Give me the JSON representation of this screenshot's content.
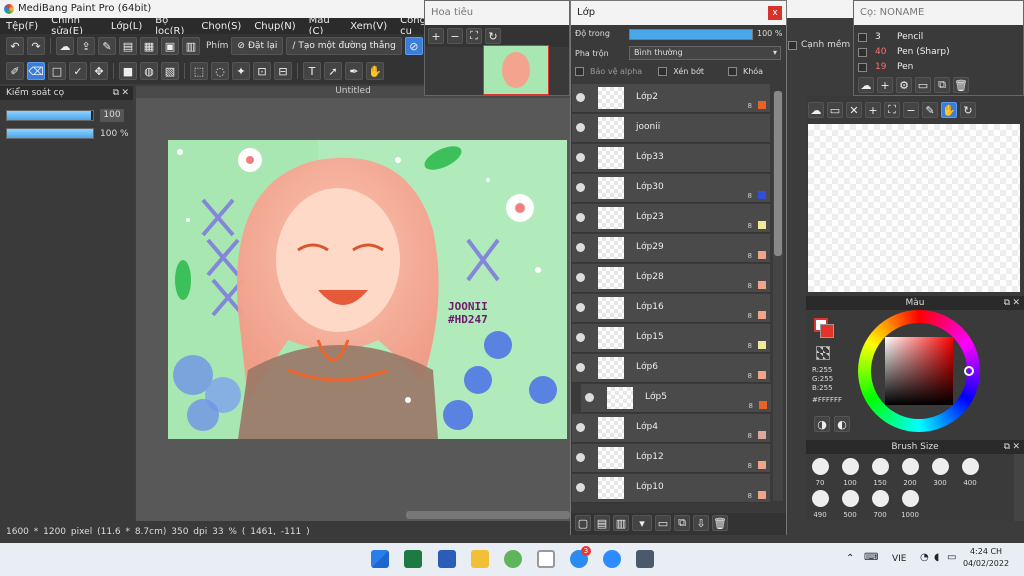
{
  "app": {
    "title": "MediBang Paint Pro (64bit)"
  },
  "menu": [
    "Tệp(F)",
    "Chỉnh sửa(E)",
    "Lớp(L)",
    "Bộ lọc(R)",
    "Chọn(S)",
    "Chụp(N)",
    "Màu (C)",
    "Xem(V)",
    "Công cụ"
  ],
  "toolbar": {
    "key_label": "Phím",
    "reset_label": "Đặt lại",
    "line_label": "Tạo một đường thẳng",
    "smooth_label": "Cạnh mềm"
  },
  "brush_control": {
    "title": "Kiểm soát cọ",
    "size_value": "100",
    "opacity_value": "100 %",
    "size_fraction": 0.98,
    "opacity_fraction": 1.0
  },
  "canvas": {
    "doc_title": "Untitled",
    "signature_line1": "JOONII",
    "signature_line2": "#HD247"
  },
  "status": {
    "size": "1600 * 1200 pixel",
    "cm": "(11.6 * 8.7cm)",
    "dpi": "350 dpi",
    "zoom": "33 %",
    "coords": "( 1461, -111 )"
  },
  "navigator": {
    "title": "Hoa tiêu"
  },
  "layers": {
    "title": "Lớp",
    "opacity_label": "Độ trong",
    "opacity_value": "100 %",
    "blend_label": "Pha trộn",
    "blend_value": "Bình thường",
    "protect_alpha": "Bảo vệ alpha",
    "clip": "Xén bớt",
    "lock": "Khóa",
    "items": [
      {
        "name": "Lớp2",
        "bits": "8",
        "color": "#e8632a"
      },
      {
        "name": "joonii",
        "bits": "",
        "color": ""
      },
      {
        "name": "Lớp33",
        "bits": "",
        "color": ""
      },
      {
        "name": "Lớp30",
        "bits": "8",
        "color": "#2f4fd8"
      },
      {
        "name": "Lớp23",
        "bits": "8",
        "color": "#f3e99b"
      },
      {
        "name": "Lớp29",
        "bits": "8",
        "color": "#f0a58a"
      },
      {
        "name": "Lớp28",
        "bits": "8",
        "color": "#f0a58a"
      },
      {
        "name": "Lớp16",
        "bits": "8",
        "color": "#f0a58a"
      },
      {
        "name": "Lớp15",
        "bits": "8",
        "color": "#f3e99b"
      },
      {
        "name": "Lớp6",
        "bits": "8",
        "color": "#f0a58a"
      },
      {
        "name": "Lớp5",
        "bits": "8",
        "color": "#e8632a"
      },
      {
        "name": "Lớp4",
        "bits": "8",
        "color": "#d9a89a"
      },
      {
        "name": "Lớp12",
        "bits": "8",
        "color": "#f0a58a"
      },
      {
        "name": "Lớp10",
        "bits": "8",
        "color": "#f0a58a"
      }
    ]
  },
  "brush_list": {
    "title": "Cọ: NONAME",
    "items": [
      {
        "size": "3",
        "name": "Pencil",
        "color": "#eeeeee"
      },
      {
        "size": "40",
        "name": "Pen (Sharp)",
        "color": "#ff6b6b"
      },
      {
        "size": "19",
        "name": "Pen",
        "color": "#ff6b6b"
      }
    ]
  },
  "color_panel": {
    "title": "Màu",
    "r": "R:255",
    "g": "G:255",
    "b": "B:255",
    "hex": "#FFFFFF"
  },
  "brush_size": {
    "title": "Brush Size",
    "sizes": [
      "70",
      "100",
      "150",
      "200",
      "300",
      "400",
      "490",
      "500",
      "700",
      "1000"
    ]
  },
  "taskbar": {
    "lang": "VIE",
    "time": "4:24 CH",
    "date": "04/02/2022",
    "badge": "3"
  }
}
